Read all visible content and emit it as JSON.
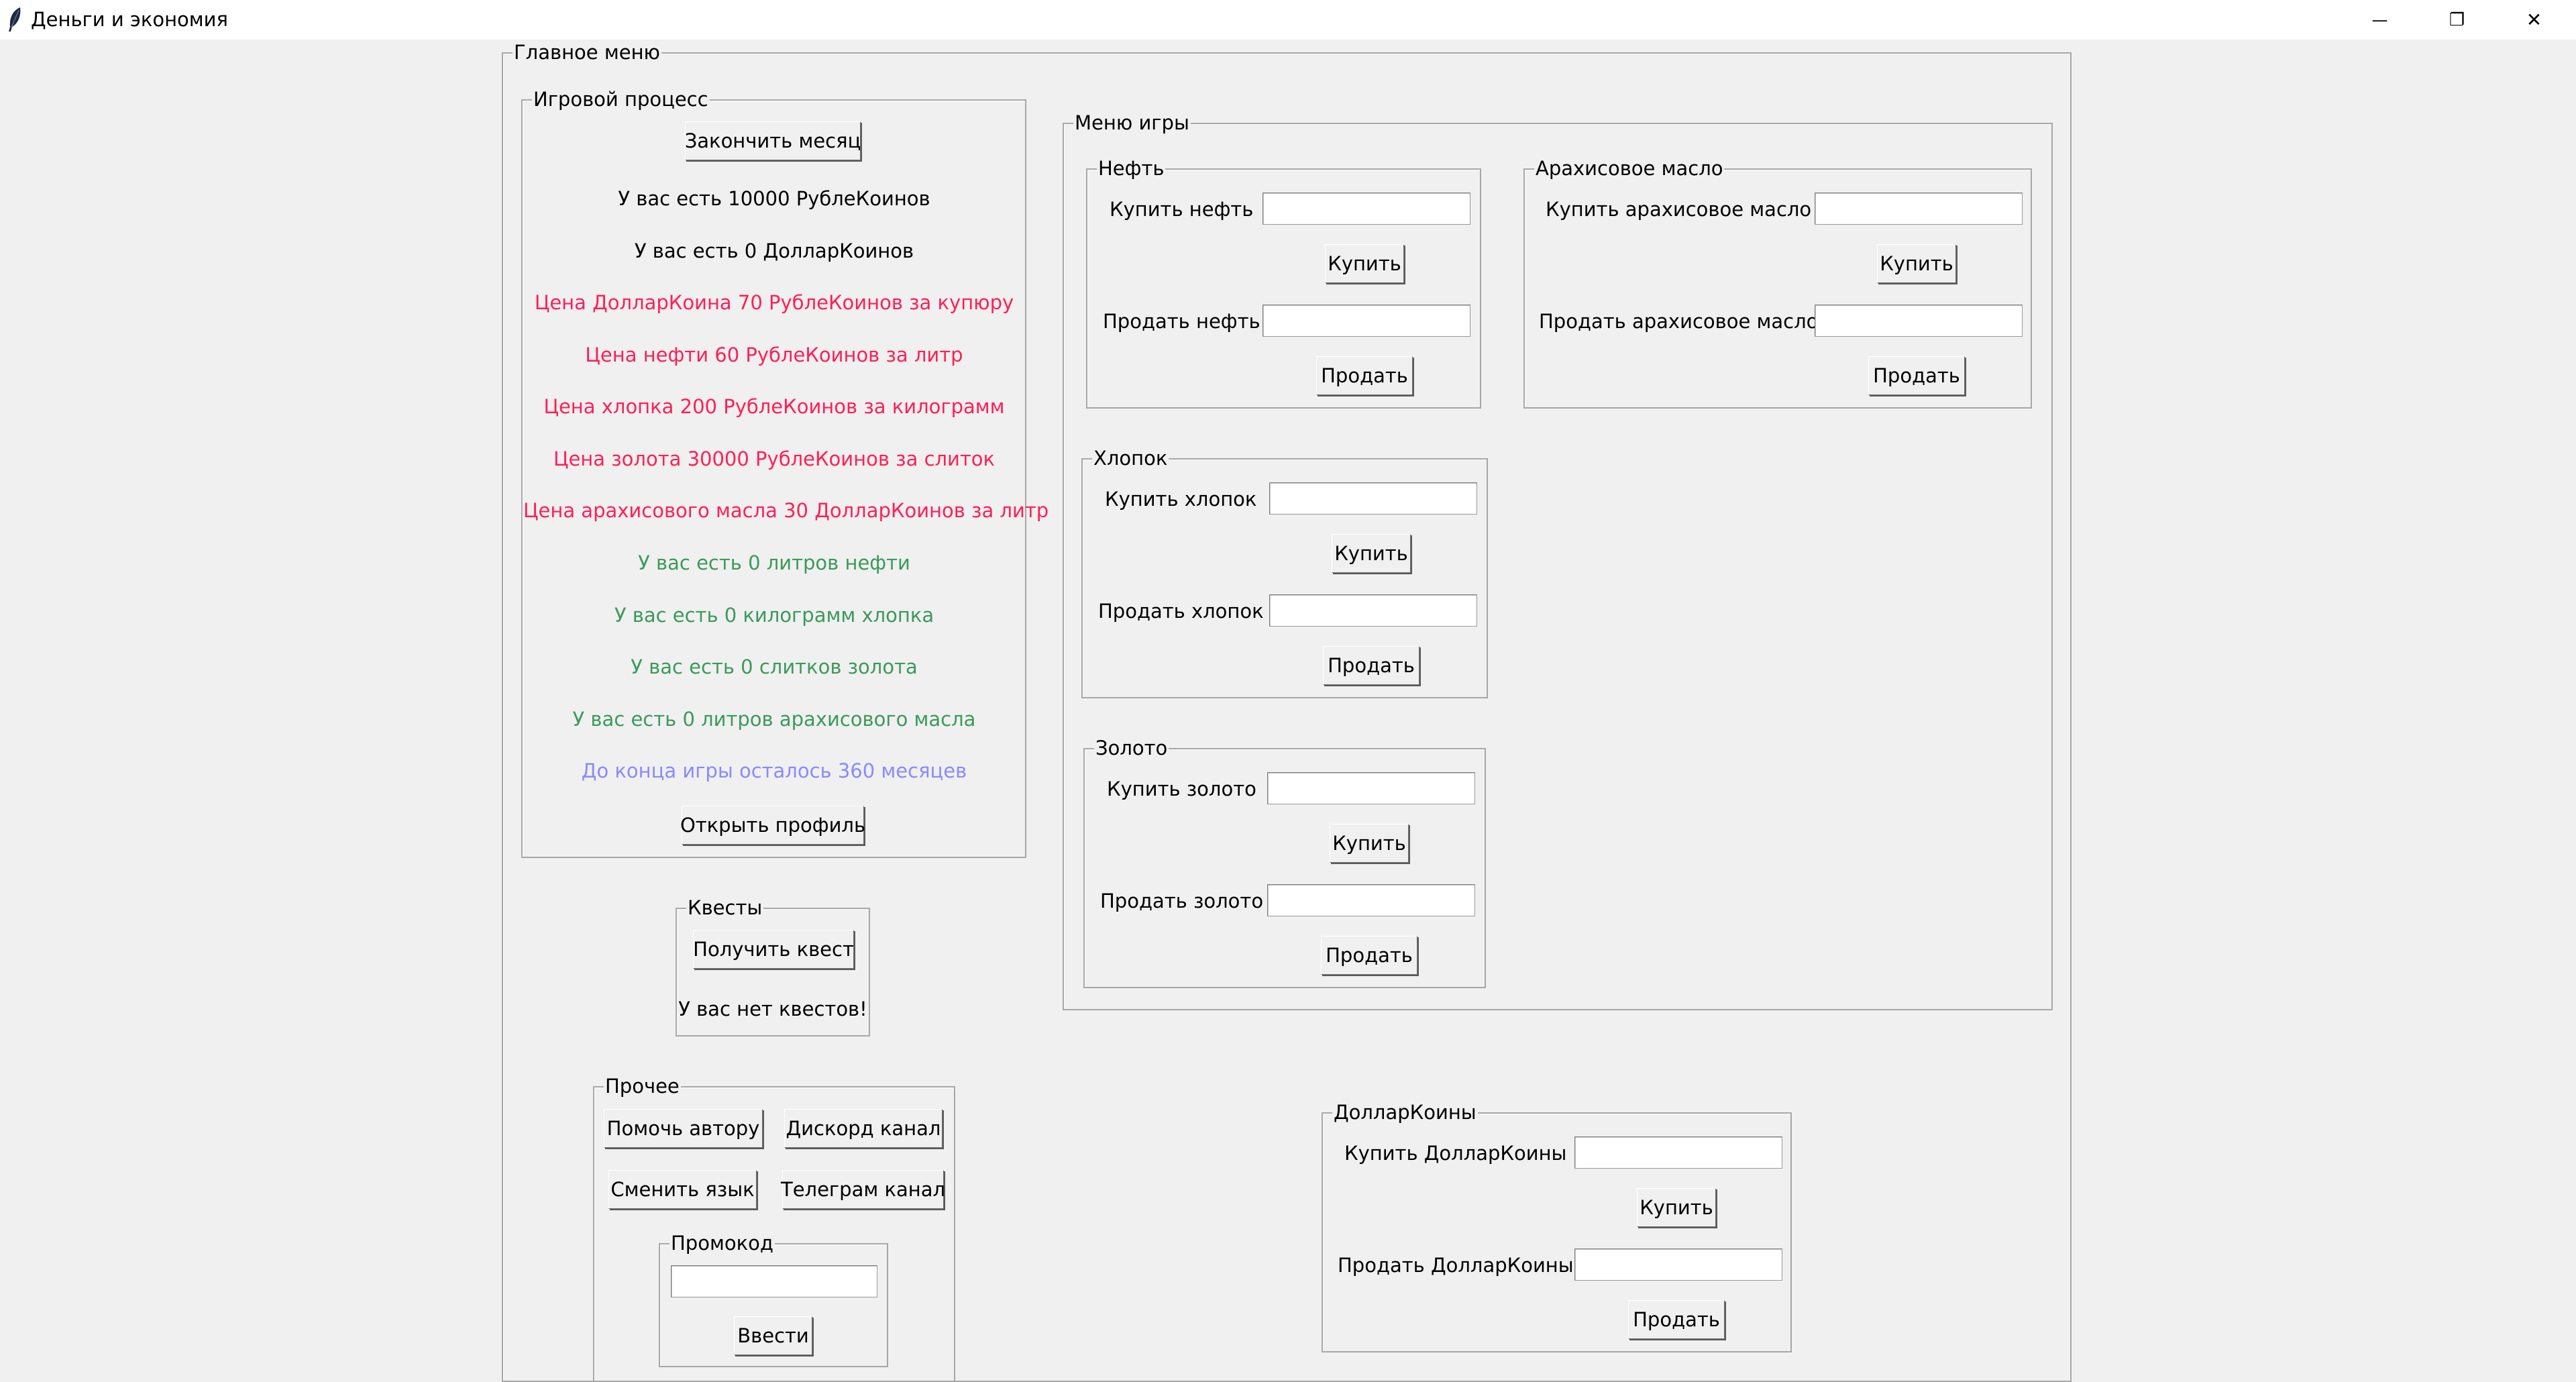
{
  "window": {
    "title": "Деньги и экономия",
    "minimize_glyph": "—",
    "restore_glyph": "❐",
    "close_glyph": "✕"
  },
  "colors": {
    "price_red": "#ff1f57",
    "inventory_green": "#3c9a5a",
    "months_blue": "#8a8aff"
  },
  "main_menu": {
    "label": "Главное меню",
    "game_process": {
      "label": "Игровой процесс",
      "end_month_button": "Закончить месяц",
      "rubles": "У вас есть 10000 РублеКоинов",
      "dollars": "У вас есть 0 ДолларКоинов",
      "price_dollar": "Цена ДолларКоина 70 РублеКоинов за купюру",
      "price_oil": "Цена нефти 60 РублеКоинов за литр",
      "price_cotton": "Цена хлопка 200 РублеКоинов за килограмм",
      "price_gold": "Цена золота 30000 РублеКоинов за слиток",
      "price_peanut": "Цена арахисового масла 30 ДолларКоинов за литр",
      "have_oil": "У вас есть 0 литров нефти",
      "have_cotton": "У вас есть 0 килограмм хлопка",
      "have_gold": "У вас есть 0 слитков золота",
      "have_peanut": "У вас есть 0 литров арахисового масла",
      "months_left": "До конца игры осталось 360 месяцев",
      "open_profile_button": "Открыть профиль"
    },
    "quests": {
      "label": "Квесты",
      "get_quest_button": "Получить квест",
      "status": "У вас нет квестов!"
    },
    "other": {
      "label": "Прочее",
      "help_author": "Помочь автору",
      "discord": "Дискорд канал",
      "change_language": "Сменить язык",
      "telegram": "Телеграм канал",
      "promo": {
        "label": "Промокод",
        "value": "",
        "enter_button": "Ввести"
      }
    },
    "game_menu": {
      "label": "Меню игры",
      "oil": {
        "label": "Нефть",
        "buy_label": "Купить нефть",
        "buy_value": "",
        "buy_button": "Купить",
        "sell_label": "Продать нефть",
        "sell_value": "",
        "sell_button": "Продать"
      },
      "peanut": {
        "label": "Арахисовое масло",
        "buy_label": "Купить арахисовое масло",
        "buy_value": "",
        "buy_button": "Купить",
        "sell_label": "Продать арахисовое масло",
        "sell_value": "",
        "sell_button": "Продать"
      },
      "cotton": {
        "label": "Хлопок",
        "buy_label": "Купить хлопок",
        "buy_value": "",
        "buy_button": "Купить",
        "sell_label": "Продать хлопок",
        "sell_value": "",
        "sell_button": "Продать"
      },
      "gold": {
        "label": "Золото",
        "buy_label": "Купить золото",
        "buy_value": "",
        "buy_button": "Купить",
        "sell_label": "Продать золото",
        "sell_value": "",
        "sell_button": "Продать"
      }
    },
    "dollarcoins": {
      "label": "ДолларКоины",
      "buy_label": "Купить ДолларКоины",
      "buy_value": "",
      "buy_button": "Купить",
      "sell_label": "Продать ДолларКоины",
      "sell_value": "",
      "sell_button": "Продать"
    }
  }
}
